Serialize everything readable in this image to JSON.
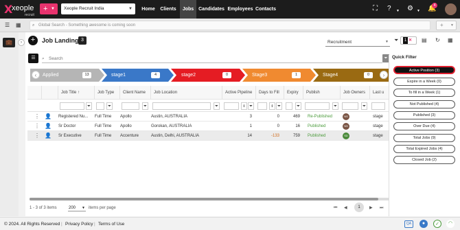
{
  "brand": {
    "name": "xeople",
    "sub": "recruit"
  },
  "topnav": {
    "add_label": "+",
    "tenant": "Xeople Recruit India",
    "links": [
      "Home",
      "Clients",
      "Jobs",
      "Candidates",
      "Employees",
      "Contacts"
    ],
    "active_link": "Jobs",
    "notification_count": "4"
  },
  "search": {
    "placeholder": "Global Search - Something awesome is coming soon",
    "plus_label": "+"
  },
  "landing": {
    "title": "Job Landing",
    "count": "3",
    "pipeline_select": "Recruitment",
    "filter_count": "1",
    "grid_search_placeholder": "Search"
  },
  "stages": [
    {
      "label": "Applied",
      "count": "13",
      "color": "#b5b5b5"
    },
    {
      "label": "stage1",
      "count": "4",
      "color": "#3a78c8"
    },
    {
      "label": "stage2",
      "count": "0",
      "color": "#e51c23"
    },
    {
      "label": "Stage3",
      "count": "1",
      "color": "#f08a30"
    },
    {
      "label": "Stage4",
      "count": "0",
      "color": "#9a6a12"
    }
  ],
  "table": {
    "columns": [
      "Job Title",
      "Job Type",
      "Client Name",
      "Job Location",
      "Active Pipeline",
      "Days to Fill",
      "Expiry",
      "Publish",
      "Job Owners",
      "Last u"
    ],
    "rows": [
      {
        "title": "Registered Nu...",
        "type": "Full Time",
        "client": "Apollo",
        "location": "Austin, AUSTRALIA",
        "pipeline": "3",
        "days": "0",
        "expiry": "469",
        "publish": "Re-Published",
        "owner": "NS",
        "last": "stage"
      },
      {
        "title": "Sr Doctor",
        "type": "Full Time",
        "client": "Apollo",
        "location": "Gorokan, AUSTRALIA",
        "pipeline": "1",
        "days": "0",
        "expiry": "16",
        "publish": "Published",
        "owner": "NS",
        "last": "stage"
      },
      {
        "title": "Sr Executive",
        "type": "Full Time",
        "client": "Accenture",
        "location": "Austin, Delhi, AUSTRALIA",
        "pipeline": "14",
        "days": "-133",
        "expiry": "759",
        "publish": "Published",
        "owner": "SD",
        "last": "stage"
      }
    ]
  },
  "pager": {
    "range": "1 - 3 of 3 items",
    "page_size": "200",
    "per_page_label": "items per page",
    "current_page": "1"
  },
  "quick_filter": {
    "title": "Quick Filter",
    "items": [
      "Active Position (3)",
      "Expire in a Week (0)",
      "To fill in a Week (1)",
      "Not Published (4)",
      "Published (3)",
      "Over Due (4)",
      "Total Jobs (9)",
      "Total Expired Jobs (4)",
      "Closed Job (2)"
    ],
    "active_index": 0
  },
  "footer": {
    "copyright": "© 2024. All Rights Reserved",
    "privacy": "Privacy Policy",
    "terms": "Terms of Use",
    "qa": "QA"
  },
  "colors": {
    "brand_pink": "#e8336e",
    "nav_bg": "#1c1c1c",
    "published_green": "#4a9a3a",
    "active_filter_border": "#e01f2f"
  }
}
